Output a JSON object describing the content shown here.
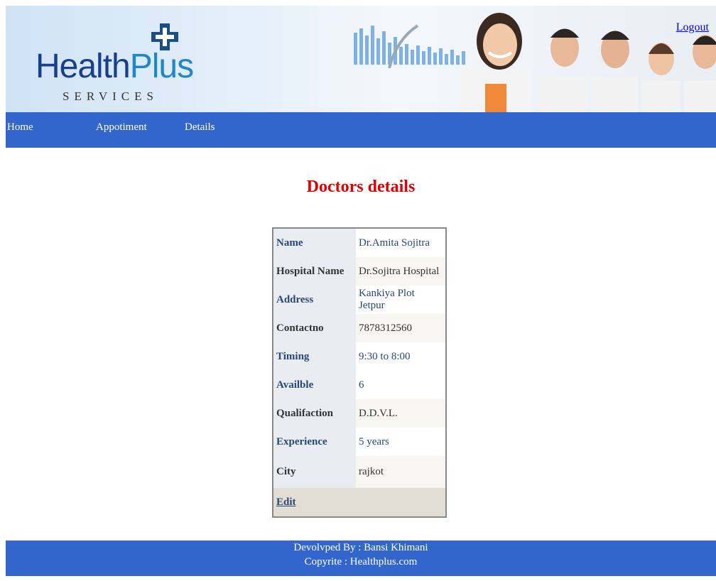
{
  "header": {
    "logo_main": "Health",
    "logo_plus": "Plus",
    "logo_sub": "SERVICES",
    "logout_label": "Logout"
  },
  "nav": {
    "items": [
      {
        "label": "Home"
      },
      {
        "label": "Appotiment"
      },
      {
        "label": "Details"
      }
    ]
  },
  "page": {
    "title": "Doctors details"
  },
  "details": {
    "rows": [
      {
        "label": "Name",
        "value": "Dr.Amita Sojitra"
      },
      {
        "label": "Hospital Name",
        "value": "Dr.Sojitra Hospital"
      },
      {
        "label": "Address",
        "value": "Kankiya Plot Jetpur"
      },
      {
        "label": "Contactno",
        "value": "7878312560"
      },
      {
        "label": "Timing",
        "value": "9:30 to 8:00"
      },
      {
        "label": "Availble",
        "value": "6"
      },
      {
        "label": "Qualifaction",
        "value": "D.D.V.L."
      },
      {
        "label": "Experience",
        "value": "5 years"
      },
      {
        "label": "City",
        "value": "rajkot"
      }
    ],
    "edit_label": "Edit"
  },
  "footer": {
    "line1": "Devolvped By : Bansi Khimani",
    "line2": "Copyrite : Healthplus.com"
  },
  "colors": {
    "nav_bg": "#3366cc",
    "title": "#e00000",
    "label_blue": "#284775"
  },
  "icons": [
    "medical-cross-icon",
    "bar-chart-graphic",
    "doctors-photo"
  ]
}
